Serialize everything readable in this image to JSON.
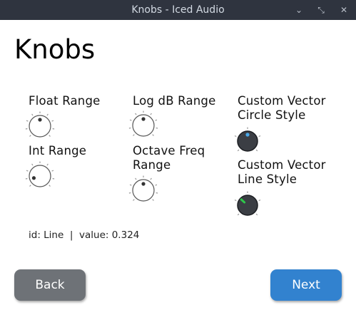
{
  "window": {
    "title": "Knobs - Iced Audio",
    "minimize_glyph": "⌄",
    "maximize_glyph": "⤡",
    "close_glyph": "✕"
  },
  "page": {
    "title": "Knobs"
  },
  "knobs": [
    {
      "id": "float-range",
      "label": "Float Range",
      "style": "default",
      "value": 0.5
    },
    {
      "id": "int-range",
      "label": "Int Range",
      "style": "default",
      "value": 0.1
    },
    {
      "id": "log-db-range",
      "label": "Log dB Range",
      "style": "default",
      "value": 0.5
    },
    {
      "id": "octave-freq-range",
      "label": "Octave Freq\nRange",
      "style": "default",
      "value": 0.5
    },
    {
      "id": "custom-vector-circle",
      "label": "Custom Vector\nCircle Style",
      "style": "circle",
      "value": 0.5,
      "accent": "#4aa8e8"
    },
    {
      "id": "custom-vector-line",
      "label": "Custom Vector\nLine Style",
      "style": "line",
      "value": 0.324,
      "accent": "#2ec84a"
    }
  ],
  "status": {
    "text": "id: Line  |  value: 0.324"
  },
  "buttons": {
    "back": "Back",
    "next": "Next"
  },
  "colors": {
    "titlebar": "#2f343f",
    "back_button": "#6e7277",
    "next_button": "#3282cf",
    "dark_knob": "#3b3e44"
  }
}
